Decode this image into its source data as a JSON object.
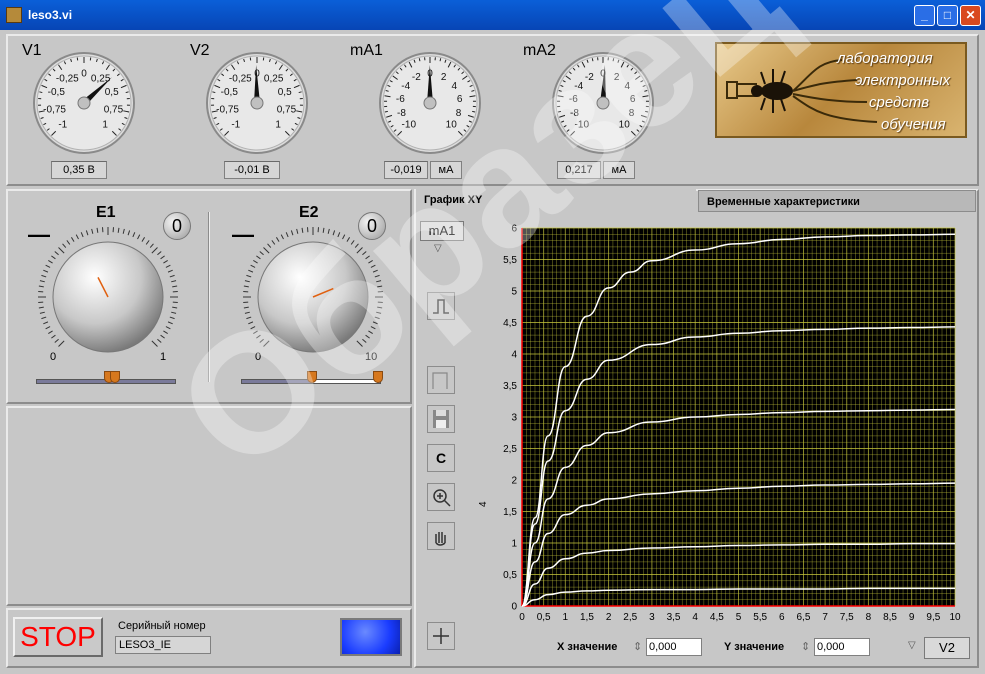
{
  "window": {
    "title": "leso3.vi"
  },
  "meters": [
    {
      "name": "V1",
      "ticks": [
        "-1",
        "-0,75",
        "-0,5",
        "-0,25",
        "0",
        "0,25",
        "0,5",
        "0,75",
        "1"
      ],
      "min": -1,
      "max": 1,
      "value": 0.35,
      "readout": "0,35 В",
      "unit": ""
    },
    {
      "name": "V2",
      "ticks": [
        "-1",
        "-0,75",
        "-0,5",
        "-0,25",
        "0",
        "0,25",
        "0,5",
        "0,75",
        "1"
      ],
      "min": -1,
      "max": 1,
      "value": -0.01,
      "readout": "-0,01 В",
      "unit": ""
    },
    {
      "name": "mA1",
      "ticks": [
        "-10",
        "-8",
        "-6",
        "-4",
        "-2",
        "0",
        "2",
        "4",
        "6",
        "8",
        "10"
      ],
      "min": -10,
      "max": 10,
      "value": -0.019,
      "readout": "-0,019",
      "unit": "мА"
    },
    {
      "name": "mA2",
      "ticks": [
        "-10",
        "-8",
        "-6",
        "-4",
        "-2",
        "0",
        "2",
        "4",
        "6",
        "8",
        "10"
      ],
      "min": -10,
      "max": 10,
      "value": 0.217,
      "readout": "0,217",
      "unit": "мА"
    }
  ],
  "logo": {
    "lines": [
      "лаборатория",
      "электронных",
      "средств",
      "обучения"
    ]
  },
  "knobs": [
    {
      "name": "E1",
      "min_label": "0",
      "max_label": "1",
      "value": 0.4,
      "counter": "0",
      "dash": "—"
    },
    {
      "name": "E2",
      "min_label": "0",
      "max_label": "10",
      "value": 0.75,
      "counter": "0",
      "dash": "—"
    }
  ],
  "tabs": {
    "active": "График XY",
    "inactive": "Временные характеристики"
  },
  "graph": {
    "y_selector": "mA1",
    "x_selector": "V2",
    "ylabel": "4",
    "x_value_label": "X значение",
    "y_value_label": "Y значение",
    "x_value": "0,000",
    "y_value": "0,000",
    "clear_button": "C"
  },
  "bottom": {
    "stop": "STOP",
    "serial_label": "Серийный номер",
    "serial_value": "LESO3_IE"
  },
  "watermark": "Образец",
  "colors": {
    "plot_bg": "#000000",
    "grid": "#c8c83c",
    "curve": "#ffffff",
    "axis": "#ff0000",
    "indicator": "#1a4cff"
  },
  "chart_data": {
    "type": "line",
    "xlim": [
      0,
      10
    ],
    "ylim": [
      0,
      6
    ],
    "x_ticks": [
      "0",
      "0,5",
      "1",
      "1,5",
      "2",
      "2,5",
      "3",
      "3,5",
      "4",
      "4,5",
      "5",
      "5,5",
      "6",
      "6,5",
      "7",
      "7,5",
      "8",
      "8,5",
      "9",
      "9,5",
      "10"
    ],
    "y_ticks": [
      "0",
      "0,5",
      "1",
      "1,5",
      "2",
      "2,5",
      "3",
      "3,5",
      "4",
      "4,5",
      "5",
      "5,5",
      "6"
    ],
    "grid": true,
    "series": [
      {
        "x": [
          0,
          0.3,
          0.6,
          1,
          1.5,
          2,
          3,
          4,
          5,
          6,
          7,
          8,
          9,
          10
        ],
        "y": [
          0,
          0.1,
          0.18,
          0.22,
          0.24,
          0.25,
          0.26,
          0.26,
          0.27,
          0.27,
          0.27,
          0.28,
          0.28,
          0.28
        ]
      },
      {
        "x": [
          0,
          0.3,
          0.6,
          1,
          1.5,
          2,
          3,
          4,
          5,
          6,
          7,
          8,
          9,
          10
        ],
        "y": [
          0,
          0.35,
          0.6,
          0.75,
          0.84,
          0.88,
          0.92,
          0.94,
          0.96,
          0.97,
          0.98,
          0.98,
          0.99,
          0.99
        ]
      },
      {
        "x": [
          0,
          0.3,
          0.6,
          1,
          1.5,
          2,
          3,
          4,
          5,
          6,
          7,
          8,
          9,
          10
        ],
        "y": [
          0,
          0.7,
          1.15,
          1.45,
          1.6,
          1.7,
          1.78,
          1.83,
          1.87,
          1.9,
          1.92,
          1.93,
          1.94,
          1.95
        ]
      },
      {
        "x": [
          0,
          0.3,
          0.6,
          1,
          1.5,
          2,
          3,
          4,
          5,
          6,
          7,
          8,
          9,
          10
        ],
        "y": [
          0,
          1,
          1.7,
          2.2,
          2.55,
          2.75,
          2.92,
          3,
          3.04,
          3.07,
          3.09,
          3.1,
          3.11,
          3.12
        ]
      },
      {
        "x": [
          0,
          0.3,
          0.6,
          1,
          1.5,
          2,
          3,
          4,
          5,
          6,
          7,
          8,
          9,
          10
        ],
        "y": [
          0,
          1.3,
          2.3,
          3.1,
          3.6,
          3.9,
          4.15,
          4.27,
          4.33,
          4.37,
          4.39,
          4.41,
          4.42,
          4.43
        ]
      },
      {
        "x": [
          0,
          0.3,
          0.6,
          1,
          1.5,
          2,
          2.5,
          3,
          4,
          5,
          6,
          7,
          8,
          9,
          10
        ],
        "y": [
          0,
          1.4,
          2.7,
          3.8,
          4.6,
          5.05,
          5.3,
          5.48,
          5.65,
          5.75,
          5.82,
          5.86,
          5.88,
          5.89,
          5.9
        ]
      }
    ]
  }
}
